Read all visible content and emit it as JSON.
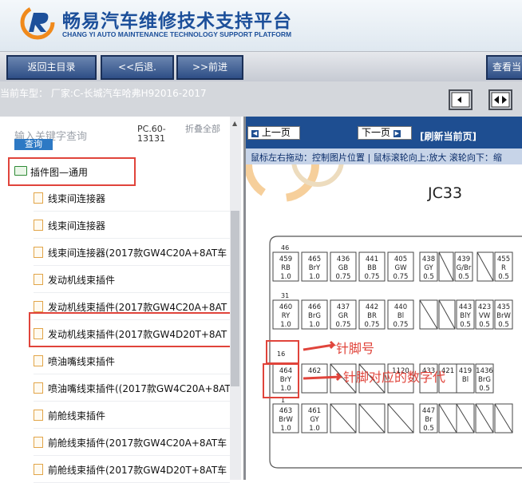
{
  "header": {
    "title": "畅易汽车维修技术支持平台",
    "subtitle": "CHANG YI AUTO MAINTENANCE TECHNOLOGY SUPPORT PLATFORM"
  },
  "nav": {
    "home": "返回主目录",
    "back": "<<后退.",
    "forward": ">>前进",
    "view": "查看当"
  },
  "info": {
    "model": "当前车型： 厂家:C-长城汽车哈弗H92016-2017"
  },
  "sidebar": {
    "search_placeholder": "输入关键字查询",
    "search_button": "查询",
    "pc_label": "PC.60-13131",
    "collapse_all": "折叠全部",
    "root": "插件图—通用",
    "items": [
      {
        "label": "线束间连接器"
      },
      {
        "label": "线束间连接器"
      },
      {
        "label": "线束间连接器(2017款GW4C20A+8AT车"
      },
      {
        "label": "发动机线束插件"
      },
      {
        "label": "发动机线束插件(2017款GW4C20A+8AT"
      },
      {
        "label": "发动机线束插件(2017款GW4D20T+8AT"
      },
      {
        "label": "喷油嘴线束插件"
      },
      {
        "label": "喷油嘴线束插件((2017款GW4C20A+8AT"
      },
      {
        "label": "前舱线束插件"
      },
      {
        "label": "前舱线束插件(2017款GW4C20A+8AT车"
      },
      {
        "label": "前舱线束插件(2017款GW4D20T+8AT车"
      }
    ]
  },
  "viewer": {
    "prev": "上一页",
    "next": "下一页",
    "refresh": "[刷新当前页]",
    "hint": "鼠标左右拖动：控制图片位置 | 鼠标滚轮向上:放大  滚轮向下：缩",
    "connector_id": "JC33",
    "annotation_pin": "针脚号",
    "annotation_code": "针脚对应的数字代",
    "row1_header": "46",
    "row1": [
      {
        "n": "459",
        "c": "RB",
        "s": "1.0"
      },
      {
        "n": "465",
        "c": "BrY",
        "s": "1.0"
      },
      {
        "n": "436",
        "c": "GB",
        "s": "0.75"
      },
      {
        "n": "441",
        "c": "BB",
        "s": "0.75"
      },
      {
        "n": "405",
        "c": "GW",
        "s": "0.75"
      },
      {
        "n": "438",
        "c": "GY",
        "s": "0.5"
      },
      {
        "n": "439",
        "c": "G/Br",
        "s": "0.5"
      },
      {
        "n": "455",
        "c": "R",
        "s": "0.5"
      }
    ],
    "row2_header": "31",
    "row2": [
      {
        "n": "460",
        "c": "RY",
        "s": "1.0"
      },
      {
        "n": "466",
        "c": "BrG",
        "s": "1.0"
      },
      {
        "n": "437",
        "c": "GR",
        "s": "0.75"
      },
      {
        "n": "442",
        "c": "BR",
        "s": "0.75"
      },
      {
        "n": "440",
        "c": "Bl",
        "s": "0.75"
      },
      {
        "n": "443",
        "c": "BlY",
        "s": "0.5"
      },
      {
        "n": "423",
        "c": "VW",
        "s": "0.5"
      },
      {
        "n": "435",
        "c": "BrW",
        "s": "0.5"
      }
    ],
    "row3_header": "16",
    "row3": [
      {
        "n": "464",
        "c": "BrY",
        "s": "1.0"
      },
      {
        "n": "462",
        "c": "",
        "s": ""
      },
      {
        "n": "1120",
        "c": "",
        "s": ""
      },
      {
        "n": "433",
        "c": "",
        "s": ""
      },
      {
        "n": "421",
        "c": "",
        "s": ""
      },
      {
        "n": "419",
        "c": "Bl",
        "s": ""
      },
      {
        "n": "1436",
        "c": "BrG",
        "s": "0.5"
      }
    ],
    "row4_header": "1",
    "row4": [
      {
        "n": "463",
        "c": "BrW",
        "s": "1.0"
      },
      {
        "n": "461",
        "c": "GY",
        "s": "1.0"
      },
      {
        "n": "447",
        "c": "Br",
        "s": "0.5"
      }
    ]
  },
  "colors": {
    "brand": "#1c4f9a",
    "highlight": "#e0443b",
    "viewer_nav": "#1e4e91"
  }
}
